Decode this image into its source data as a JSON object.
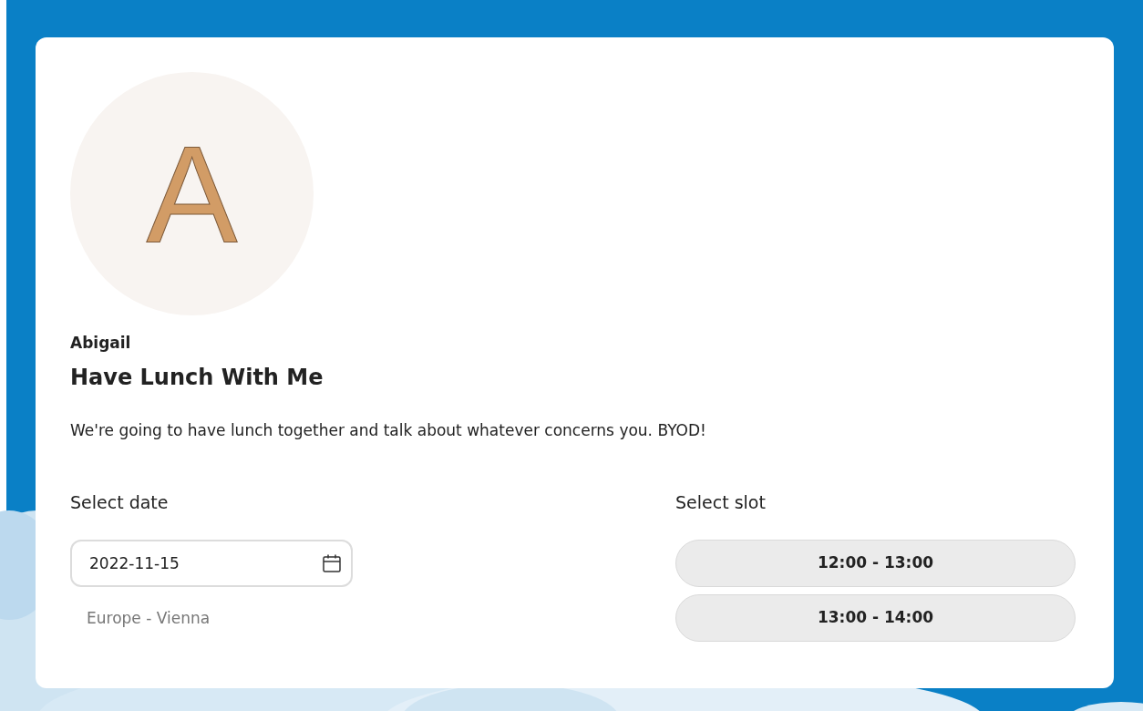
{
  "avatar": {
    "initial": "A"
  },
  "host": "Abigail",
  "title": "Have Lunch With Me",
  "description": "We're going to have lunch together and talk about whatever concerns you. BYOD!",
  "date": {
    "label": "Select date",
    "value": "2022-11-15",
    "timezone": "Europe - Vienna"
  },
  "slots": {
    "label": "Select slot",
    "items": [
      {
        "label": "12:00 - 13:00"
      },
      {
        "label": "13:00 - 14:00"
      }
    ]
  }
}
